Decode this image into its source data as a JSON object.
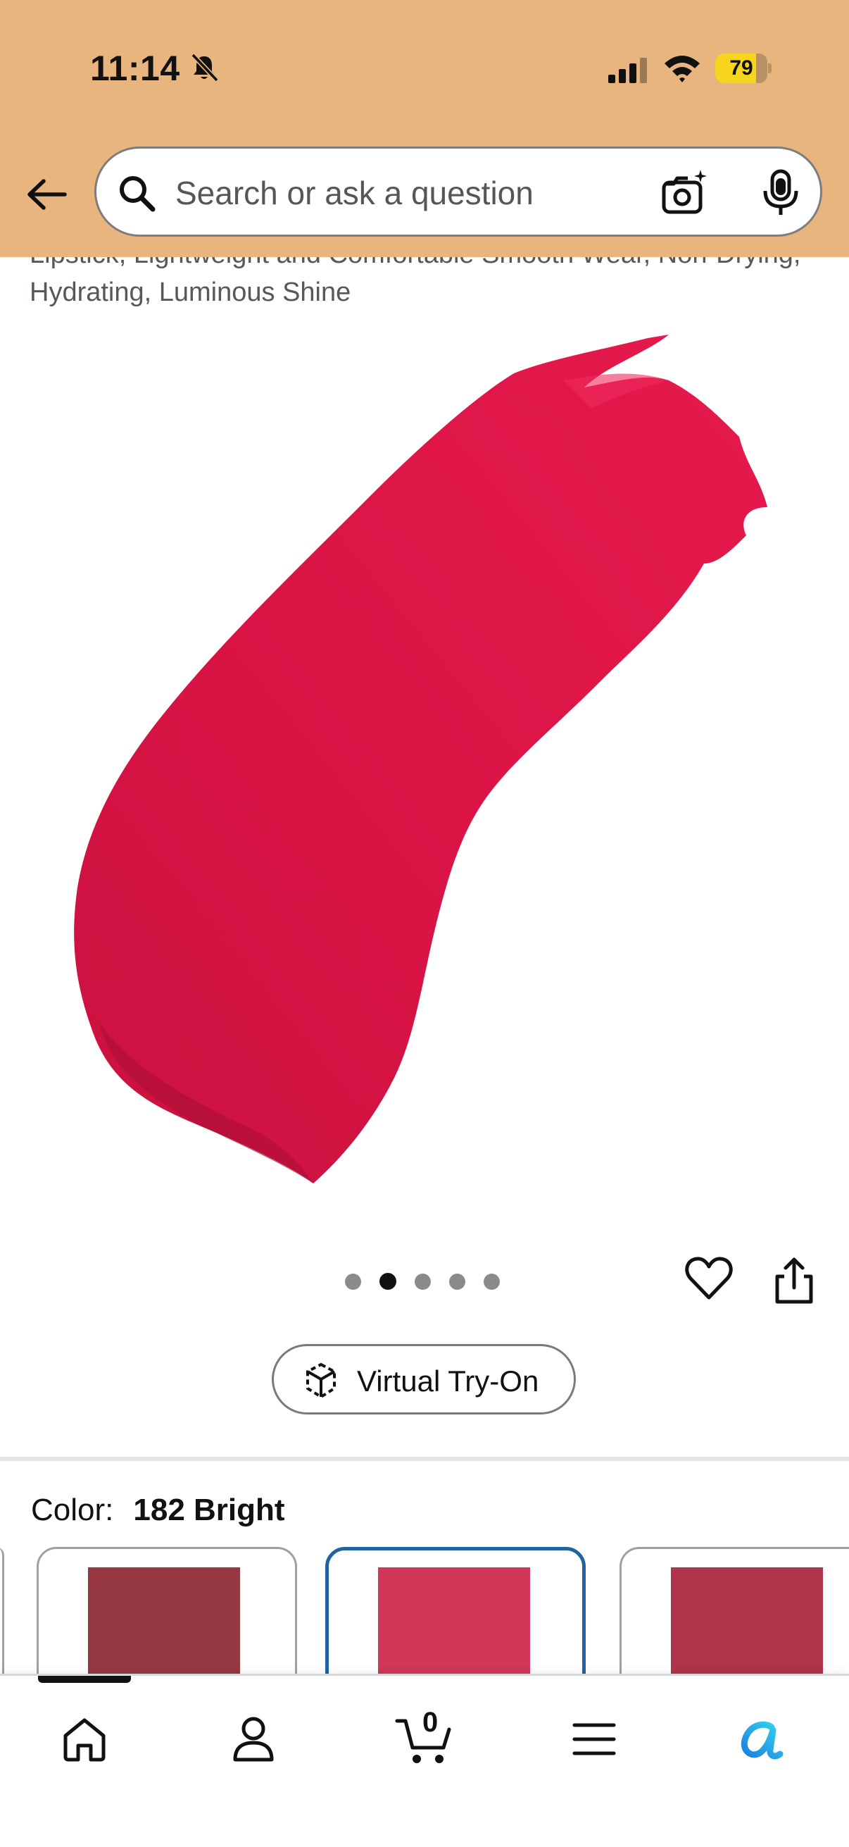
{
  "status_bar": {
    "time": "11:14",
    "battery": "79",
    "battery_level": 0.79
  },
  "header": {
    "search_placeholder": "Search or ask a question",
    "background_color": "#e8b57f"
  },
  "product": {
    "title_visible_tail": "Lipstick, Lightweight and Comfortable Smooth Wear, Non-Drying, Hydrating, Luminous Shine",
    "image_color": "#dc1446",
    "image_count": 5,
    "active_image": 2
  },
  "actions": {
    "virtual_try_on_label": "Virtual Try-On"
  },
  "variations": {
    "color_label": "Color:",
    "selected_color": "182 Bright",
    "swatches": [
      {
        "color": "#953841",
        "selected": false
      },
      {
        "color": "#d03758",
        "selected": true
      },
      {
        "color": "#b0344b",
        "selected": false
      }
    ],
    "selected_border_color": "#2162a1"
  },
  "bottom_nav": {
    "items": [
      "home-icon",
      "account-icon",
      "cart-icon",
      "menu-icon",
      "rufus-icon"
    ],
    "cart_count": "0",
    "active": "home"
  }
}
